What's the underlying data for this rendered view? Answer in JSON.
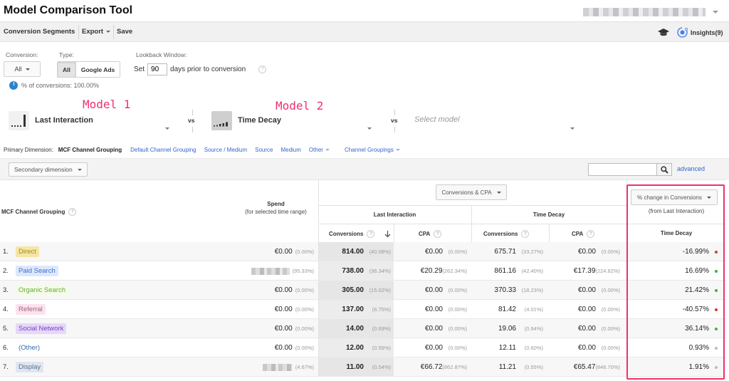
{
  "header": {
    "title": "Model Comparison Tool",
    "account_selector": "account-selector-blurred"
  },
  "toolbar": {
    "conversion_segments": "Conversion Segments",
    "export": "Export",
    "save": "Save",
    "insights": "Insights(9)"
  },
  "controls": {
    "conversion_label": "Conversion:",
    "conversion_value": "All",
    "type_label": "Type:",
    "type_options": [
      "All",
      "Google Ads"
    ],
    "type_selected": "All",
    "lookback_label": "Lookback Window:",
    "lookback_prefix": "Set",
    "lookback_days": "90",
    "lookback_suffix": "days prior to conversion",
    "help_glyph": "?",
    "pct_conversions": "% of conversions: 100.00%"
  },
  "models": {
    "annotation_1": "Model 1",
    "annotation_2": "Model 2",
    "model_1": "Last Interaction",
    "model_2": "Time Decay",
    "vs": "vs",
    "model_3_placeholder": "Select model"
  },
  "dimensions": {
    "label": "Primary Dimension:",
    "current": "MCF Channel Grouping",
    "links": [
      "Default Channel Grouping",
      "Source / Medium",
      "Source",
      "Medium",
      "Other"
    ],
    "channel_groupings": "Channel Groupings"
  },
  "filter": {
    "secondary_dimension": "Secondary dimension",
    "search_value": "",
    "advanced": "advanced"
  },
  "table": {
    "dim_header": "MCF Channel Grouping",
    "spend_header": "Spend",
    "spend_sub": "(for selected time range)",
    "metric_selector": "Conversions & CPA",
    "model_1_header": "Last Interaction",
    "model_2_header": "Time Decay",
    "conversions_header": "Conversions",
    "cpa_header": "CPA",
    "change_selector": "% change in Conversions",
    "change_sub": "(from Last Interaction)",
    "change_col_header": "Time Decay",
    "rows": [
      {
        "rank": "1.",
        "channel": "Direct",
        "spend": "€0.00",
        "spend_pct": "(0.00%)",
        "spend_blurred": false,
        "li_conv": "814.00",
        "li_conv_pct": "(40.08%)",
        "li_cpa": "€0.00",
        "li_cpa_pct": "(0.00%)",
        "td_conv": "675.71",
        "td_conv_pct": "(33.27%)",
        "td_cpa": "€0.00",
        "td_cpa_pct": "(0.00%)",
        "change": "-16.99%",
        "trend": "down"
      },
      {
        "rank": "2.",
        "channel": "Paid Search",
        "spend": "",
        "spend_pct": "(95.33%)",
        "spend_blurred": true,
        "li_conv": "738.00",
        "li_conv_pct": "(36.34%)",
        "li_cpa": "€20.29",
        "li_cpa_pct": "(262.34%)",
        "td_conv": "861.16",
        "td_conv_pct": "(42.40%)",
        "td_cpa": "€17.39",
        "td_cpa_pct": "(224.82%)",
        "change": "16.69%",
        "trend": "up"
      },
      {
        "rank": "3.",
        "channel": "Organic Search",
        "spend": "€0.00",
        "spend_pct": "(0.00%)",
        "spend_blurred": false,
        "li_conv": "305.00",
        "li_conv_pct": "(15.02%)",
        "li_cpa": "€0.00",
        "li_cpa_pct": "(0.00%)",
        "td_conv": "370.33",
        "td_conv_pct": "(18.23%)",
        "td_cpa": "€0.00",
        "td_cpa_pct": "(0.00%)",
        "change": "21.42%",
        "trend": "up"
      },
      {
        "rank": "4.",
        "channel": "Referral",
        "spend": "€0.00",
        "spend_pct": "(0.00%)",
        "spend_blurred": false,
        "li_conv": "137.00",
        "li_conv_pct": "(6.75%)",
        "li_cpa": "€0.00",
        "li_cpa_pct": "(0.00%)",
        "td_conv": "81.42",
        "td_conv_pct": "(4.01%)",
        "td_cpa": "€0.00",
        "td_cpa_pct": "(0.00%)",
        "change": "-40.57%",
        "trend": "down"
      },
      {
        "rank": "5.",
        "channel": "Social Network",
        "spend": "€0.00",
        "spend_pct": "(0.00%)",
        "spend_blurred": false,
        "li_conv": "14.00",
        "li_conv_pct": "(0.69%)",
        "li_cpa": "€0.00",
        "li_cpa_pct": "(0.00%)",
        "td_conv": "19.06",
        "td_conv_pct": "(0.94%)",
        "td_cpa": "€0.00",
        "td_cpa_pct": "(0.00%)",
        "change": "36.14%",
        "trend": "up"
      },
      {
        "rank": "6.",
        "channel": "(Other)",
        "spend": "€0.00",
        "spend_pct": "(0.00%)",
        "spend_blurred": false,
        "li_conv": "12.00",
        "li_conv_pct": "(0.59%)",
        "li_cpa": "€0.00",
        "li_cpa_pct": "(0.00%)",
        "td_conv": "12.11",
        "td_conv_pct": "(0.60%)",
        "td_cpa": "€0.00",
        "td_cpa_pct": "(0.00%)",
        "change": "0.93%",
        "trend": "neutral"
      },
      {
        "rank": "7.",
        "channel": "Display",
        "spend": "",
        "spend_pct": "(4.67%)",
        "spend_blurred": true,
        "li_conv": "11.00",
        "li_conv_pct": "(0.54%)",
        "li_cpa": "€66.72",
        "li_cpa_pct": "(862.87%)",
        "td_conv": "11.21",
        "td_conv_pct": "(0.55%)",
        "td_cpa": "€65.47",
        "td_cpa_pct": "(846.70%)",
        "change": "1.91%",
        "trend": "neutral"
      }
    ]
  },
  "colors": {
    "annotation": "#f0306b",
    "link": "#3366cc",
    "trend_up": "#3fae49",
    "trend_down": "#e8312b",
    "trend_neutral": "#bbbbbb",
    "channel_tags": {
      "Direct": {
        "bg": "#f6e6a6",
        "fg": "#a38a1e"
      },
      "Paid Search": {
        "bg": "#dde8fb",
        "fg": "#3a6fd8"
      },
      "Organic Search": {
        "bg": "#f4fbe8",
        "fg": "#6aa83a"
      },
      "Referral": {
        "bg": "#fbe3ee",
        "fg": "#a06080"
      },
      "Social Network": {
        "bg": "#e5d8f8",
        "fg": "#7b3fc9"
      },
      "(Other)": {
        "bg": "transparent",
        "fg": "#2f6db5"
      },
      "Display": {
        "bg": "#dfe6f1",
        "fg": "#5d6f8c"
      }
    }
  }
}
